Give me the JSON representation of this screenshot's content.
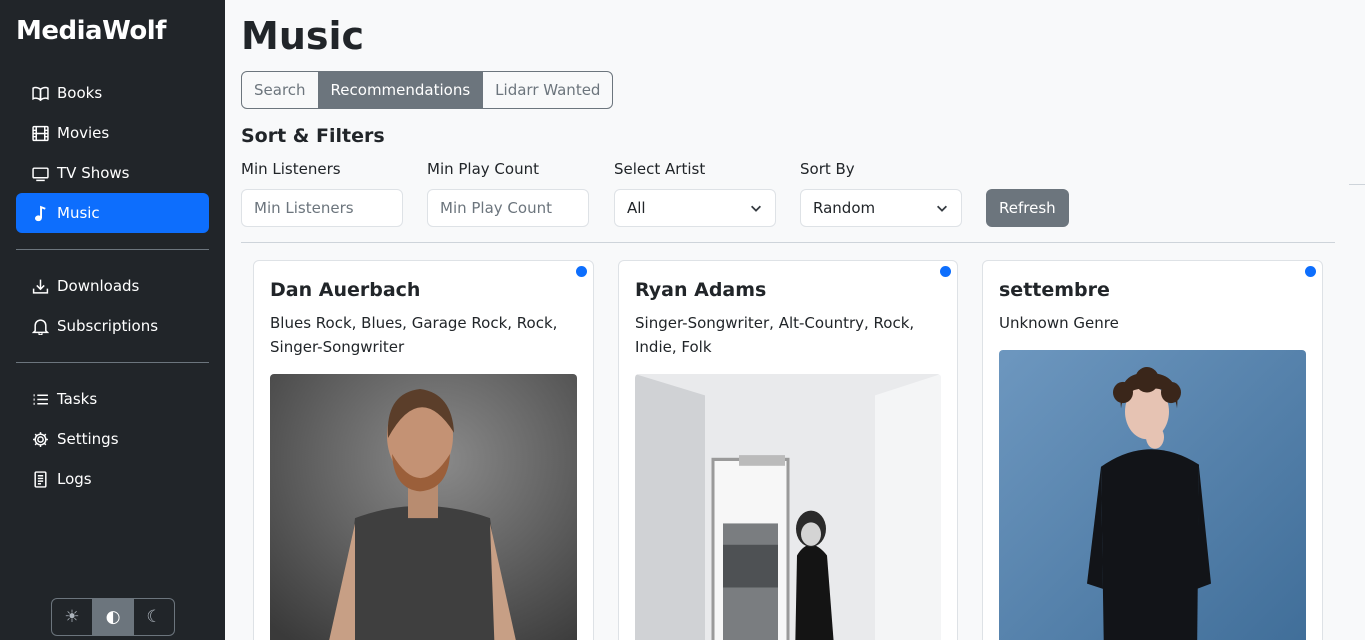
{
  "app": {
    "brand": "MediaWolf"
  },
  "sidebar": {
    "group1": [
      {
        "label": "Books",
        "icon": "book-icon",
        "active": false
      },
      {
        "label": "Movies",
        "icon": "film-icon",
        "active": false
      },
      {
        "label": "TV Shows",
        "icon": "tv-icon",
        "active": false
      },
      {
        "label": "Music",
        "icon": "music-note-icon",
        "active": true
      }
    ],
    "group2": [
      {
        "label": "Downloads",
        "icon": "download-icon"
      },
      {
        "label": "Subscriptions",
        "icon": "bell-icon"
      }
    ],
    "group3": [
      {
        "label": "Tasks",
        "icon": "list-icon"
      },
      {
        "label": "Settings",
        "icon": "gear-icon"
      },
      {
        "label": "Logs",
        "icon": "document-icon"
      }
    ],
    "theme": {
      "options": [
        "sun-icon",
        "contrast-icon",
        "moon-icon"
      ],
      "selected": "contrast-icon"
    }
  },
  "main": {
    "title": "Music",
    "tabs": [
      {
        "label": "Search",
        "active": false
      },
      {
        "label": "Recommendations",
        "active": true
      },
      {
        "label": "Lidarr Wanted",
        "active": false
      }
    ],
    "filters": {
      "section_title": "Sort & Filters",
      "min_listeners": {
        "label": "Min Listeners",
        "placeholder": "Min Listeners"
      },
      "min_play_count": {
        "label": "Min Play Count",
        "placeholder": "Min Play Count"
      },
      "select_artist": {
        "label": "Select Artist",
        "value": "All"
      },
      "sort_by": {
        "label": "Sort By",
        "value": "Random"
      },
      "refresh_label": "Refresh"
    },
    "cards": [
      {
        "name": "Dan Auerbach",
        "genre": "Blues Rock, Blues, Garage Rock, Rock, Singer-Songwriter"
      },
      {
        "name": "Ryan Adams",
        "genre": "Singer-Songwriter, Alt-Country, Rock, Indie, Folk"
      },
      {
        "name": "settembre",
        "genre": "Unknown Genre"
      }
    ]
  },
  "colors": {
    "accent": "#0d6efd",
    "sidebar_bg": "#212529",
    "secondary": "#6c757d"
  }
}
